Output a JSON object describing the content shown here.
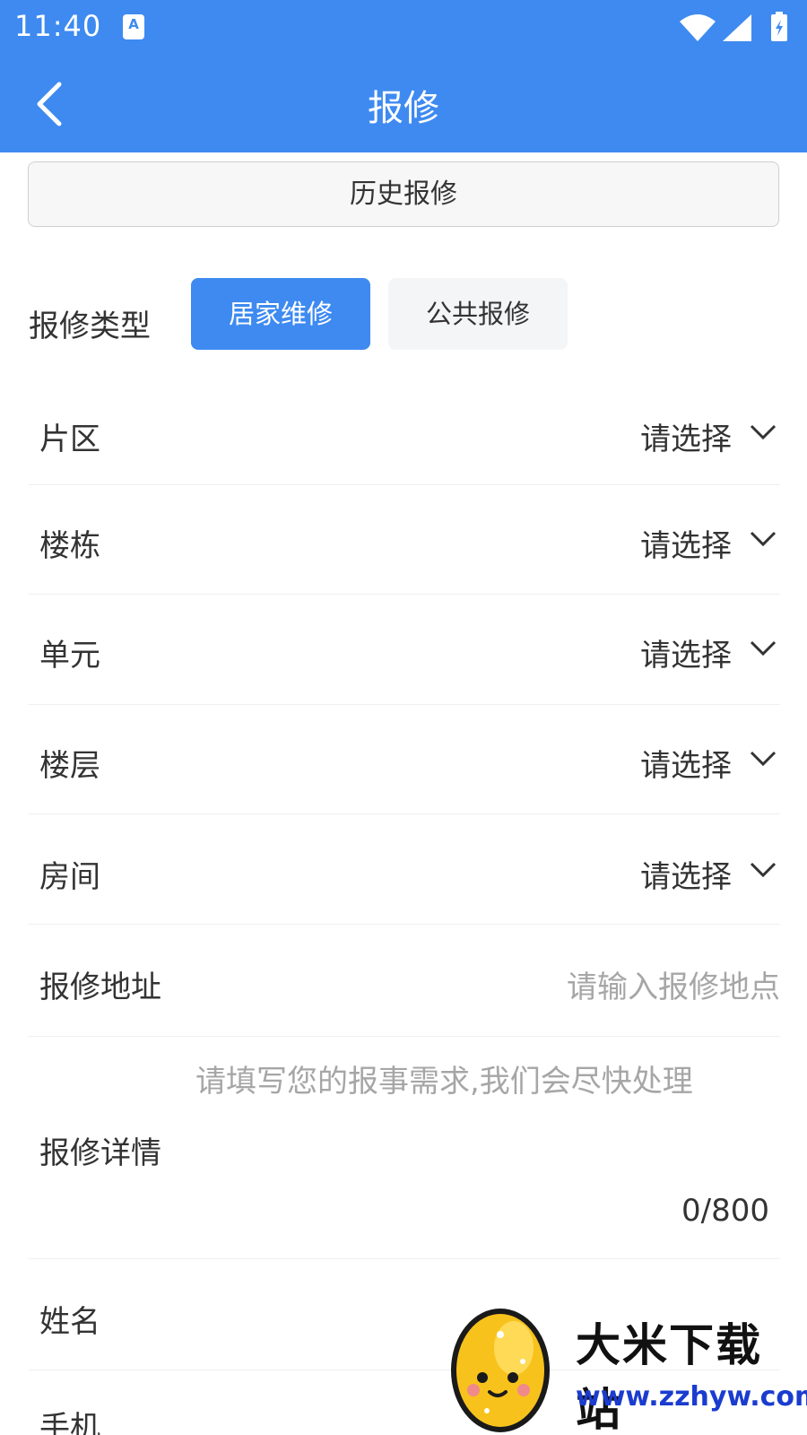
{
  "status_bar": {
    "time": "11:40",
    "notif_letter": "A",
    "icons": [
      "wifi-icon",
      "signal-icon",
      "battery-icon"
    ]
  },
  "app_bar": {
    "title": "报修",
    "back_icon": "chevron-left-icon"
  },
  "history_button": "历史报修",
  "repair_type": {
    "label": "报修类型",
    "options": [
      "居家维修",
      "公共报修"
    ],
    "selected": "居家维修"
  },
  "selects": [
    {
      "label": "片区",
      "value": "请选择"
    },
    {
      "label": "楼栋",
      "value": "请选择"
    },
    {
      "label": "单元",
      "value": "请选择"
    },
    {
      "label": "楼层",
      "value": "请选择"
    },
    {
      "label": "房间",
      "value": "请选择"
    }
  ],
  "address": {
    "label": "报修地址",
    "placeholder": "请输入报修地点"
  },
  "detail": {
    "label": "报修详情",
    "placeholder": "请填写您的报事需求,我们会尽快处理",
    "counter": "0/800"
  },
  "name": {
    "label": "姓名"
  },
  "phone": {
    "label": "手机"
  },
  "watermark": {
    "title": "大米下载站",
    "url": "www.zzhyw.com"
  },
  "colors": {
    "primary": "#3e8af0",
    "text": "#333333",
    "placeholder": "#a6a6a6",
    "divider": "#efefef"
  }
}
